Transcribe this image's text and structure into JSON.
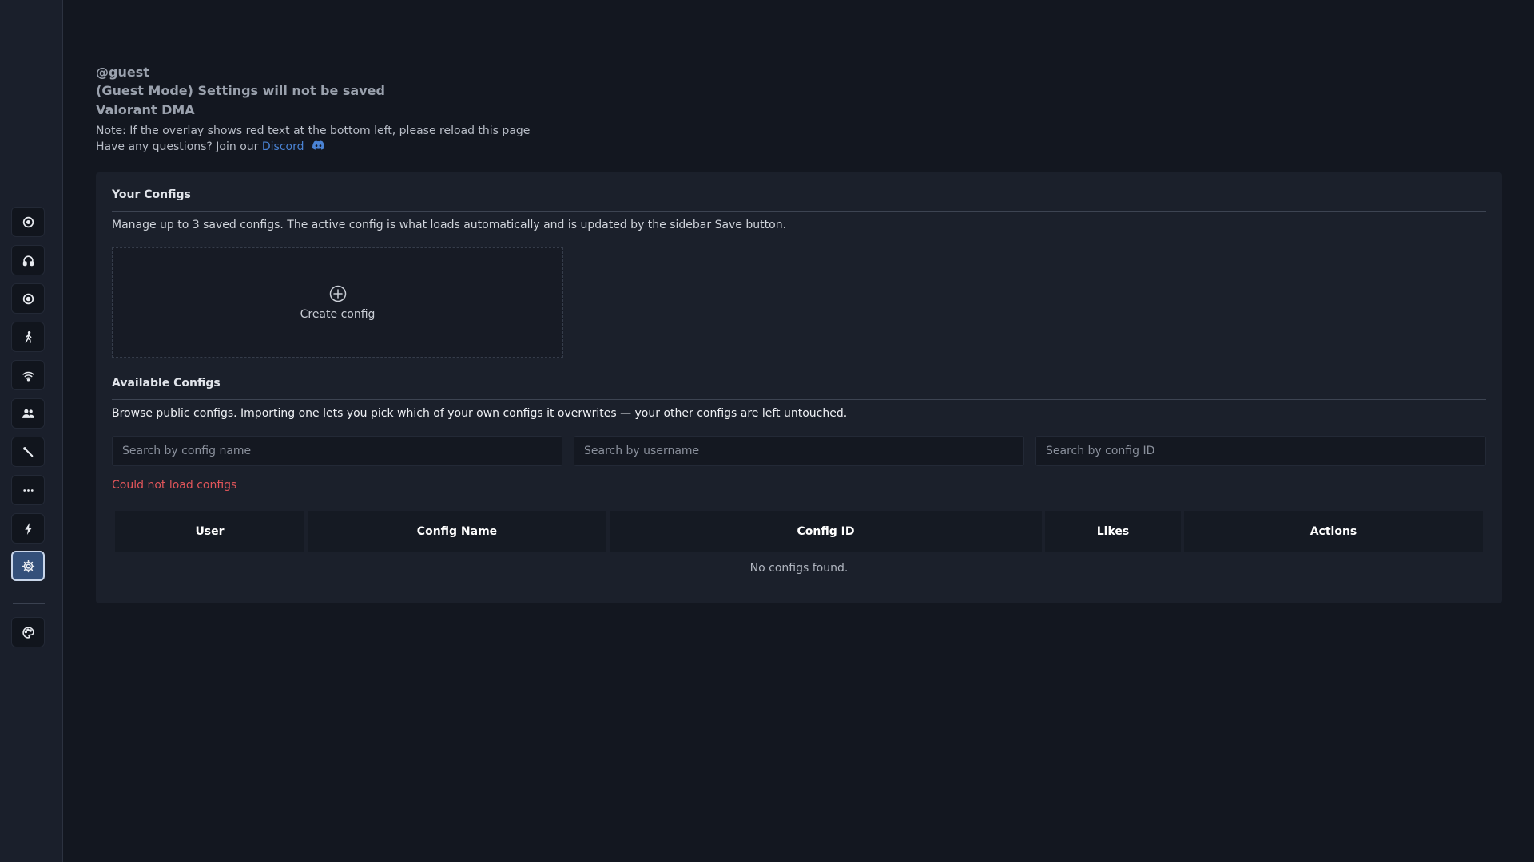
{
  "header": {
    "user": "@guest",
    "guest_notice": "(Guest Mode) Settings will not be saved",
    "product": "Valorant DMA",
    "note": "Note: If the overlay shows red text at the bottom left, please reload this page",
    "questions_prefix": "Have any questions? Join our",
    "discord_label": "Discord"
  },
  "sidebar": {
    "items": [
      {
        "icon": "crosshair-icon"
      },
      {
        "icon": "headphones-icon"
      },
      {
        "icon": "target-icon"
      },
      {
        "icon": "person-walking-icon"
      },
      {
        "icon": "wifi-icon"
      },
      {
        "icon": "users-icon"
      },
      {
        "icon": "wrench-icon"
      },
      {
        "icon": "ellipsis-icon"
      },
      {
        "icon": "lightning-icon"
      },
      {
        "icon": "gear-icon",
        "active": true
      }
    ],
    "footer_icon": "palette-icon"
  },
  "your_configs": {
    "title": "Your Configs",
    "description": "Manage up to 3 saved configs. The active config is what loads automatically and is updated by the sidebar Save button.",
    "create_label": "Create config"
  },
  "available_configs": {
    "title": "Available Configs",
    "description": "Browse public configs. Importing one lets you pick which of your own configs it overwrites — your other configs are left untouched.",
    "search_name_placeholder": "Search by config name",
    "search_username_placeholder": "Search by username",
    "search_id_placeholder": "Search by config ID",
    "error": "Could not load configs",
    "columns": [
      "User",
      "Config Name",
      "Config ID",
      "Likes",
      "Actions"
    ],
    "empty_message": "No configs found."
  },
  "colors": {
    "background": "#131720",
    "panel": "#1b202b",
    "accent": "#4a83d4",
    "error": "#e0555a",
    "active_sidebar": "#34507a"
  }
}
